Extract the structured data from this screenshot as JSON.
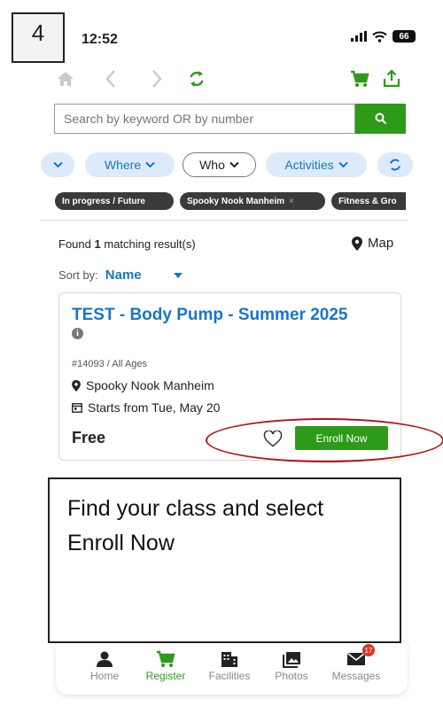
{
  "step_number": "4",
  "status_bar": {
    "time": "12:52",
    "battery": "66"
  },
  "search": {
    "placeholder": "Search by keyword OR by number"
  },
  "filters": {
    "where": "Where",
    "who": "Who",
    "activities": "Activities"
  },
  "tags": [
    "In progress / Future",
    "Spooky Nook Manheim",
    "Fitness & Gro"
  ],
  "results": {
    "found_count": "1",
    "found_text": "matching result(s)",
    "found_prefix": "Found",
    "map_label": "Map"
  },
  "sort": {
    "label": "Sort by:",
    "value": "Name"
  },
  "card": {
    "title": "TEST - Body Pump - Summer 2025",
    "meta": "#14093 / All Ages",
    "location": "Spooky Nook Manheim",
    "starts": "Starts from Tue, May 20",
    "price": "Free",
    "enroll_label": "Enroll Now"
  },
  "instruction": "Find your class and select Enroll Now",
  "bottom_nav": [
    {
      "label": "Home",
      "icon": "person-icon"
    },
    {
      "label": "Register",
      "icon": "cart-icon",
      "active": true
    },
    {
      "label": "Facilities",
      "icon": "building-icon"
    },
    {
      "label": "Photos",
      "icon": "photos-icon"
    },
    {
      "label": "Messages",
      "icon": "mail-icon",
      "badge": "17"
    }
  ],
  "colors": {
    "accent_green": "#2e9a1a",
    "link_blue": "#1676c8",
    "highlight_red": "#b0141c"
  }
}
